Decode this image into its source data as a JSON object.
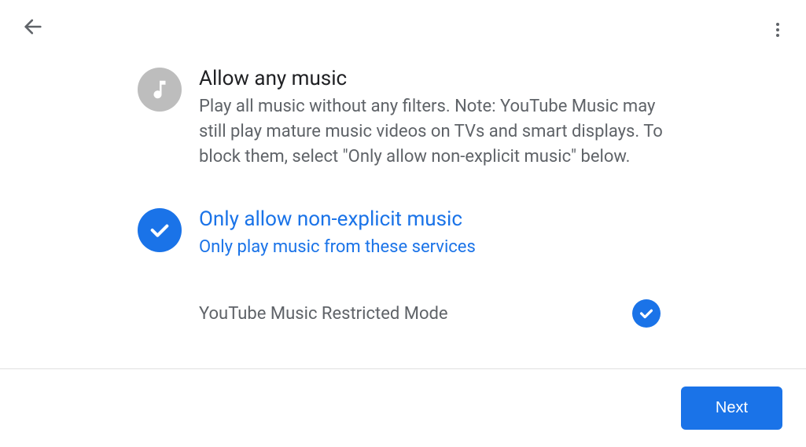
{
  "options": [
    {
      "title": "Allow any music",
      "description": "Play all music without any filters. Note: YouTube Music may still play mature music videos on TVs and smart displays. To block them, select \"Only allow non-explicit music\" below.",
      "selected": false
    },
    {
      "title": "Only allow non-explicit music",
      "description": "Only play music from these services",
      "selected": true
    }
  ],
  "subOption": {
    "label": "YouTube Music Restricted Mode",
    "checked": true
  },
  "footer": {
    "next_label": "Next"
  }
}
